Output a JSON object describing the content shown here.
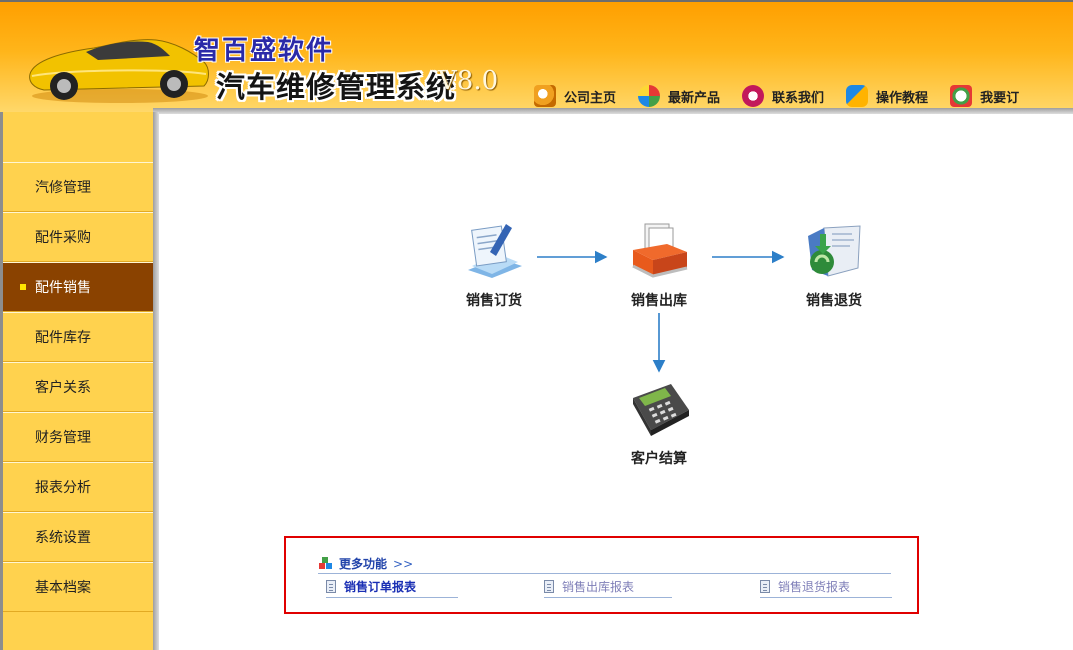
{
  "brand": {
    "company": "智百盛软件",
    "product": "汽车维修管理系统",
    "version": "V8.0"
  },
  "topnav": [
    {
      "label": "公司主页",
      "icon": "home-icon"
    },
    {
      "label": "最新产品",
      "icon": "new-products-icon"
    },
    {
      "label": "联系我们",
      "icon": "contact-icon"
    },
    {
      "label": "操作教程",
      "icon": "tutorial-icon"
    },
    {
      "label": "我要订",
      "icon": "order-icon"
    }
  ],
  "sidebar": {
    "items": [
      {
        "label": "汽修管理"
      },
      {
        "label": "配件采购"
      },
      {
        "label": "配件销售",
        "active": true
      },
      {
        "label": "配件库存"
      },
      {
        "label": "客户关系"
      },
      {
        "label": "财务管理"
      },
      {
        "label": "报表分析"
      },
      {
        "label": "系统设置"
      },
      {
        "label": "基本档案"
      }
    ]
  },
  "flow": {
    "sales_order": "销售订货",
    "sales_outbound": "销售出库",
    "sales_return": "销售退货",
    "customer_settlement": "客户结算"
  },
  "more": {
    "title": "更多功能",
    "chevron": ">>",
    "links": [
      {
        "label": "销售订单报表",
        "color": "#1a2fb4",
        "bold": true
      },
      {
        "label": "销售出库报表",
        "color": "#7f7fb8",
        "bold": false
      },
      {
        "label": "销售退货报表",
        "color": "#7f7fb8",
        "bold": false
      }
    ]
  },
  "colors": {
    "header_orange": "#ffa000",
    "sidebar_yellow": "#ffd24e",
    "sidebar_active": "#8a4200",
    "arrow_blue": "#2d7fc8",
    "highlight_red": "#e00000"
  }
}
